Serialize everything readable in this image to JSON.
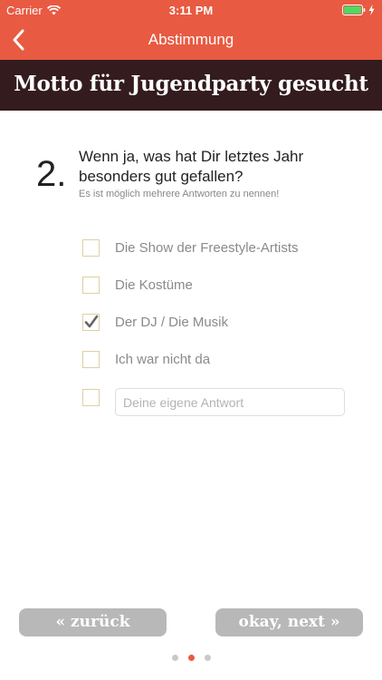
{
  "status_bar": {
    "carrier": "Carrier",
    "time": "3:11 PM"
  },
  "nav": {
    "title": "Abstimmung",
    "back_icon": "chevron-left-icon"
  },
  "banner": {
    "title": "Motto für Jugendparty gesucht"
  },
  "question": {
    "number": "2.",
    "title": "Wenn ja, was hat Dir letztes Jahr besonders gut gefallen?",
    "hint": "Es ist möglich mehrere Antworten zu nennen!"
  },
  "options": [
    {
      "label": "Die Show der Freestyle-Artists",
      "checked": false
    },
    {
      "label": "Die Kostüme",
      "checked": false
    },
    {
      "label": "Der DJ / Die Musik",
      "checked": true
    },
    {
      "label": "Ich war nicht da",
      "checked": false
    }
  ],
  "custom_answer": {
    "placeholder": "Deine eigene Antwort",
    "value": ""
  },
  "buttons": {
    "back": "« zurück",
    "next": "okay, next »"
  },
  "pagination": {
    "total": 3,
    "current": 2
  },
  "colors": {
    "accent": "#e85a41",
    "banner": "#331b1e",
    "button": "#b8b8b8",
    "checkbox_border": "#e0cfa6"
  }
}
